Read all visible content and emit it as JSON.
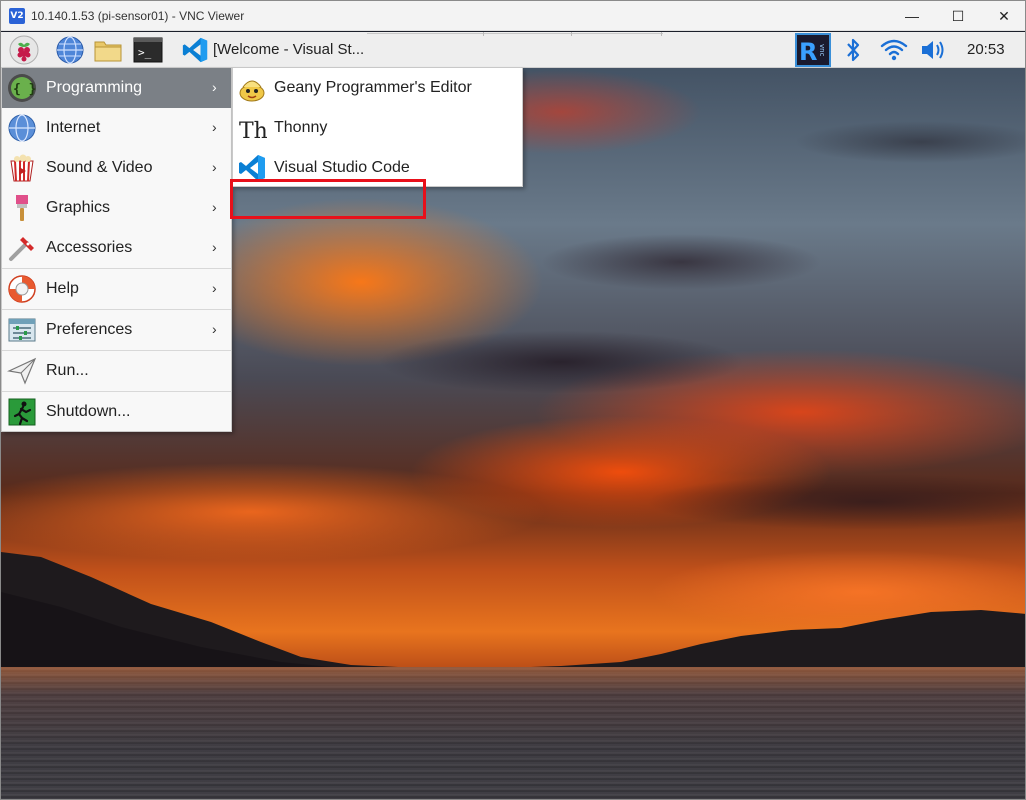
{
  "vnc": {
    "logo": "V2",
    "title": "10.140.1.53 (pi-sensor01) - VNC Viewer",
    "controls": {
      "minimize": "—",
      "maximize": "☐",
      "close": "✕"
    }
  },
  "panel": {
    "launchers": [
      "raspberry-menu-icon",
      "web-browser-icon",
      "file-manager-icon",
      "terminal-icon"
    ],
    "terminal_glyph": ">_",
    "task": {
      "label": "[Welcome - Visual St...",
      "icon": "vscode-icon"
    },
    "tray": {
      "vnc_badge": "R",
      "vnc_badge_small": "vnc",
      "icons": [
        "vnc-server-icon",
        "bluetooth-icon",
        "wifi-icon",
        "volume-icon"
      ]
    },
    "clock": "20:53"
  },
  "menu": {
    "items": [
      {
        "label": "Programming",
        "icon": "programming-icon",
        "glyph": "{ }",
        "has_submenu": true,
        "active": true
      },
      {
        "label": "Internet",
        "icon": "internet-icon",
        "has_submenu": true
      },
      {
        "label": "Sound & Video",
        "icon": "sound-video-icon",
        "has_submenu": true
      },
      {
        "label": "Graphics",
        "icon": "graphics-icon",
        "has_submenu": true
      },
      {
        "label": "Accessories",
        "icon": "accessories-icon",
        "has_submenu": true
      },
      {
        "label": "Help",
        "icon": "help-icon",
        "has_submenu": true
      },
      {
        "label": "Preferences",
        "icon": "preferences-icon",
        "has_submenu": true
      },
      {
        "label": "Run...",
        "icon": "run-icon",
        "has_submenu": false
      },
      {
        "label": "Shutdown...",
        "icon": "shutdown-icon",
        "has_submenu": false
      }
    ],
    "arrow": "›"
  },
  "submenu": {
    "items": [
      {
        "label": "Geany Programmer's Editor",
        "icon": "geany-icon"
      },
      {
        "label": "Thonny",
        "icon": "thonny-icon",
        "glyph": "Th"
      },
      {
        "label": "Visual Studio Code",
        "icon": "vscode-icon",
        "highlighted": true
      }
    ]
  },
  "colors": {
    "highlight_box": "#e8101a",
    "menu_active": "#7b8086",
    "vscode_blue": "#0a7fd4"
  }
}
